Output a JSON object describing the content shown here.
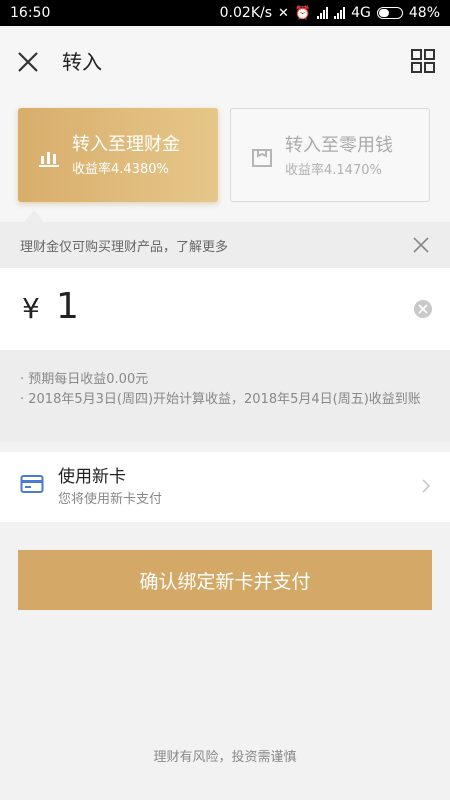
{
  "status_bar": {
    "time": "16:50",
    "speed": "0.02K/s",
    "network": "4G",
    "battery": "48%",
    "battery_level": 0.48
  },
  "header": {
    "title": "转入",
    "close_icon": "close-icon",
    "grid_icon": "grid-icon"
  },
  "options": [
    {
      "title": "转入至理财金",
      "rate": "收益率4.4380%",
      "icon": "bar-chart-icon",
      "active": true
    },
    {
      "title": "转入至零用钱",
      "rate": "收益率4.1470%",
      "icon": "wallet-icon",
      "active": false
    }
  ],
  "notice": {
    "text": "理财金仅可购买理财产品，了解更多"
  },
  "amount": {
    "currency": "¥",
    "value": "1"
  },
  "info": {
    "line1": "· 预期每日收益0.00元",
    "line2": "· 2018年5月3日(周四)开始计算收益，2018年5月4日(周五)收益到账"
  },
  "payment": {
    "title": "使用新卡",
    "subtitle": "您将使用新卡支付",
    "icon": "card-icon"
  },
  "confirm_label": "确认绑定新卡并支付",
  "footer": "理财有风险，投资需谨慎",
  "colors": {
    "accent": "#d4a866",
    "card_icon": "#4a7bd0"
  }
}
